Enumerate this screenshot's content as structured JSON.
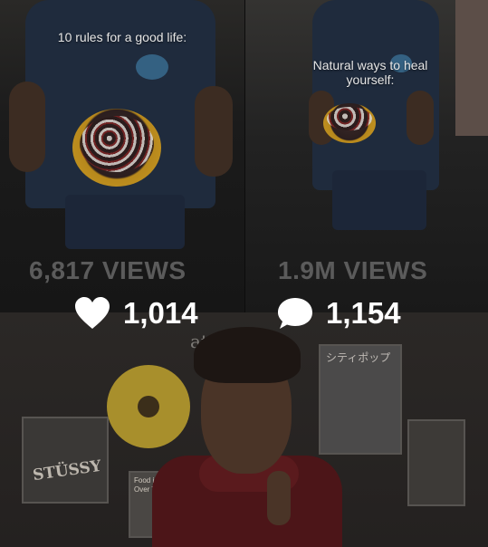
{
  "left_video": {
    "caption": "10 rules for a good life:",
    "views": "6,817 VIEWS"
  },
  "right_video": {
    "caption": "Natural ways to heal yourself:",
    "views": "1.9M VIEWS"
  },
  "stats": {
    "likes": "1,014",
    "comments": "1,154"
  },
  "background": {
    "ghost_text": "ateos ha",
    "poster_stussy": "STÜSSY",
    "poster_japanese": "シティポップ",
    "poster_small": "Food is Mind Over Thought"
  },
  "icons": {
    "like": "heart-icon",
    "comment": "comment-bubble-icon"
  }
}
